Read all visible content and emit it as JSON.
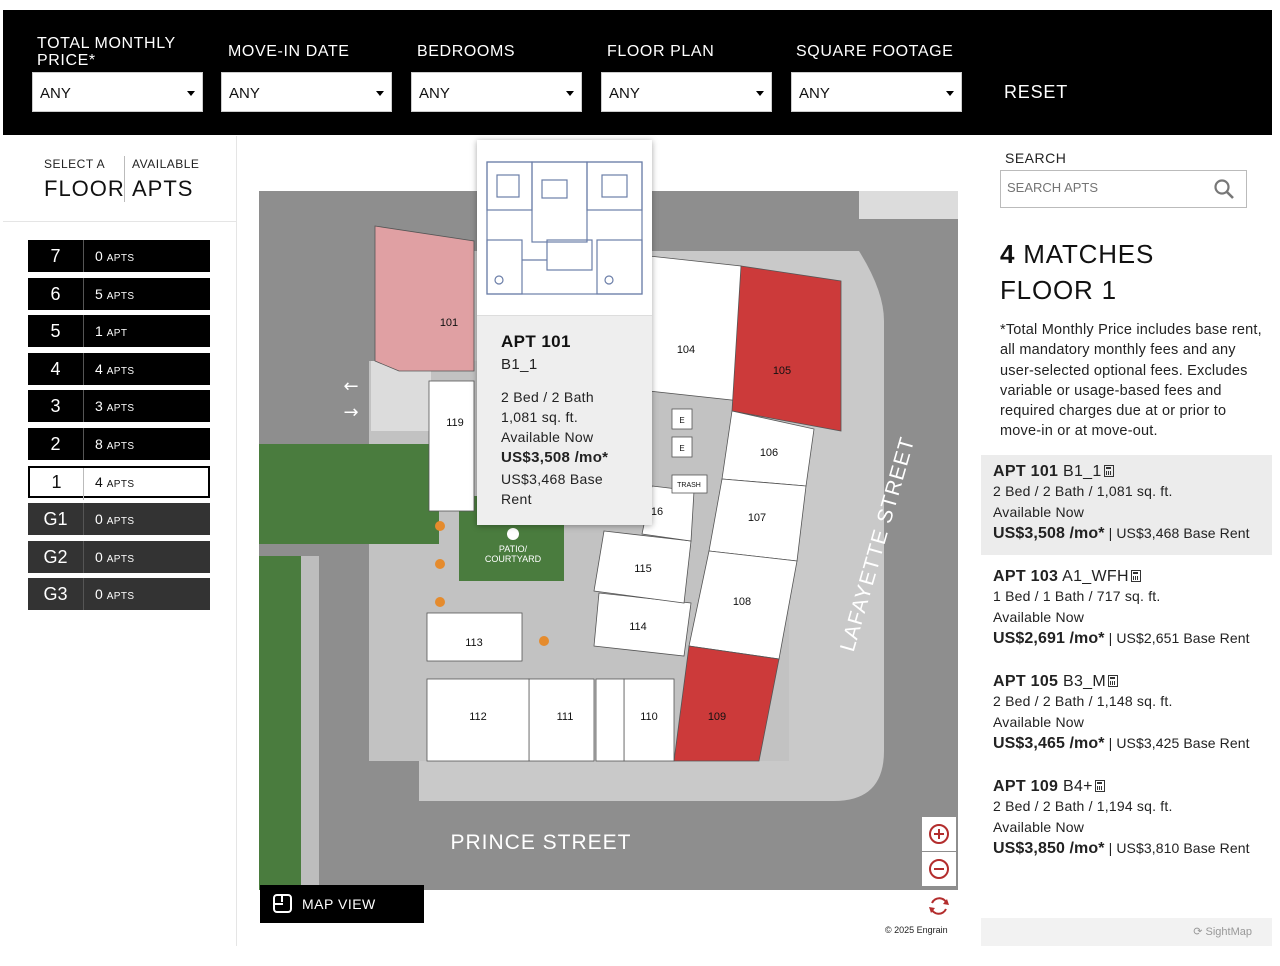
{
  "filters": [
    {
      "label": "TOTAL MONTHLY PRICE*",
      "value": "ANY"
    },
    {
      "label": "MOVE-IN DATE",
      "value": "ANY"
    },
    {
      "label": "BEDROOMS",
      "value": "ANY"
    },
    {
      "label": "FLOOR PLAN",
      "value": "ANY"
    },
    {
      "label": "SQUARE FOOTAGE",
      "value": "ANY"
    }
  ],
  "reset_label": "RESET",
  "left": {
    "select_a": "SELECT A",
    "floor": "FLOOR",
    "available": "AVAILABLE",
    "apts": "APTS",
    "floors": [
      {
        "num": "7",
        "count": "0",
        "unit": "APTS"
      },
      {
        "num": "6",
        "count": "5",
        "unit": "APTS"
      },
      {
        "num": "5",
        "count": "1",
        "unit": "APT"
      },
      {
        "num": "4",
        "count": "4",
        "unit": "APTS"
      },
      {
        "num": "3",
        "count": "3",
        "unit": "APTS"
      },
      {
        "num": "2",
        "count": "8",
        "unit": "APTS"
      },
      {
        "num": "1",
        "count": "4",
        "unit": "APTS",
        "active": true
      },
      {
        "num": "G1",
        "count": "0",
        "unit": "APTS"
      },
      {
        "num": "G2",
        "count": "0",
        "unit": "APTS"
      },
      {
        "num": "G3",
        "count": "0",
        "unit": "APTS"
      }
    ]
  },
  "map": {
    "units": [
      "101",
      "104",
      "105",
      "106",
      "107",
      "108",
      "109",
      "110",
      "111",
      "112",
      "113",
      "114",
      "115",
      "116",
      "119"
    ],
    "labels": {
      "trash": "TRASH",
      "elevator": "E",
      "patio_line1": "PATIO/",
      "patio_line2": "COURTYARD",
      "street_south": "PRINCE STREET",
      "street_east": "LAFAYETTE STREET"
    },
    "colors": {
      "available": "#cc3a3a",
      "selected": "#e0a0a3",
      "unit": "#ffffff",
      "road": "#8e8e8e",
      "green": "#4a7c3e"
    },
    "map_view_label": "MAP VIEW",
    "copyright": "© 2025 Engrain"
  },
  "popup": {
    "apt": "APT 101",
    "plan": "B1_1",
    "beds": "2 Bed / 2 Bath",
    "sqft": "1,081 sq. ft.",
    "availability": "Available Now",
    "price": "US$3,508 /mo*",
    "base_line1": "US$3,468 Base",
    "base_line2": "Rent"
  },
  "right": {
    "search_label": "SEARCH",
    "search_placeholder": "SEARCH APTS",
    "matches_count": "4",
    "matches_word": "MATCHES",
    "floor_label": "FLOOR 1",
    "disclaimer": "*Total Monthly Price includes base rent, all mandatory monthly fees and any user-selected optional fees. Excludes variable or usage-based fees and required charges due at or prior to move-in or at move-out.",
    "results": [
      {
        "apt": "APT 101",
        "plan": "B1_1",
        "details": "2 Bed / 2 Bath / 1,081 sq. ft.",
        "availability": "Available Now",
        "price": "US$3,508 /mo*",
        "base": "US$3,468 Base Rent",
        "selected": true
      },
      {
        "apt": "APT 103",
        "plan": "A1_WFH",
        "details": "1 Bed / 1 Bath / 717 sq. ft.",
        "availability": "Available Now",
        "price": "US$2,691 /mo*",
        "base": "US$2,651 Base Rent"
      },
      {
        "apt": "APT 105",
        "plan": "B3_M",
        "details": "2 Bed / 2 Bath / 1,148 sq. ft.",
        "availability": "Available Now",
        "price": "US$3,465 /mo*",
        "base": "US$3,425 Base Rent"
      },
      {
        "apt": "APT 109",
        "plan": "B4+",
        "details": "2 Bed / 2 Bath / 1,194 sq. ft.",
        "availability": "Available Now",
        "price": "US$3,850 /mo*",
        "base": "US$3,810 Base Rent"
      }
    ],
    "brand": "SightMap"
  }
}
